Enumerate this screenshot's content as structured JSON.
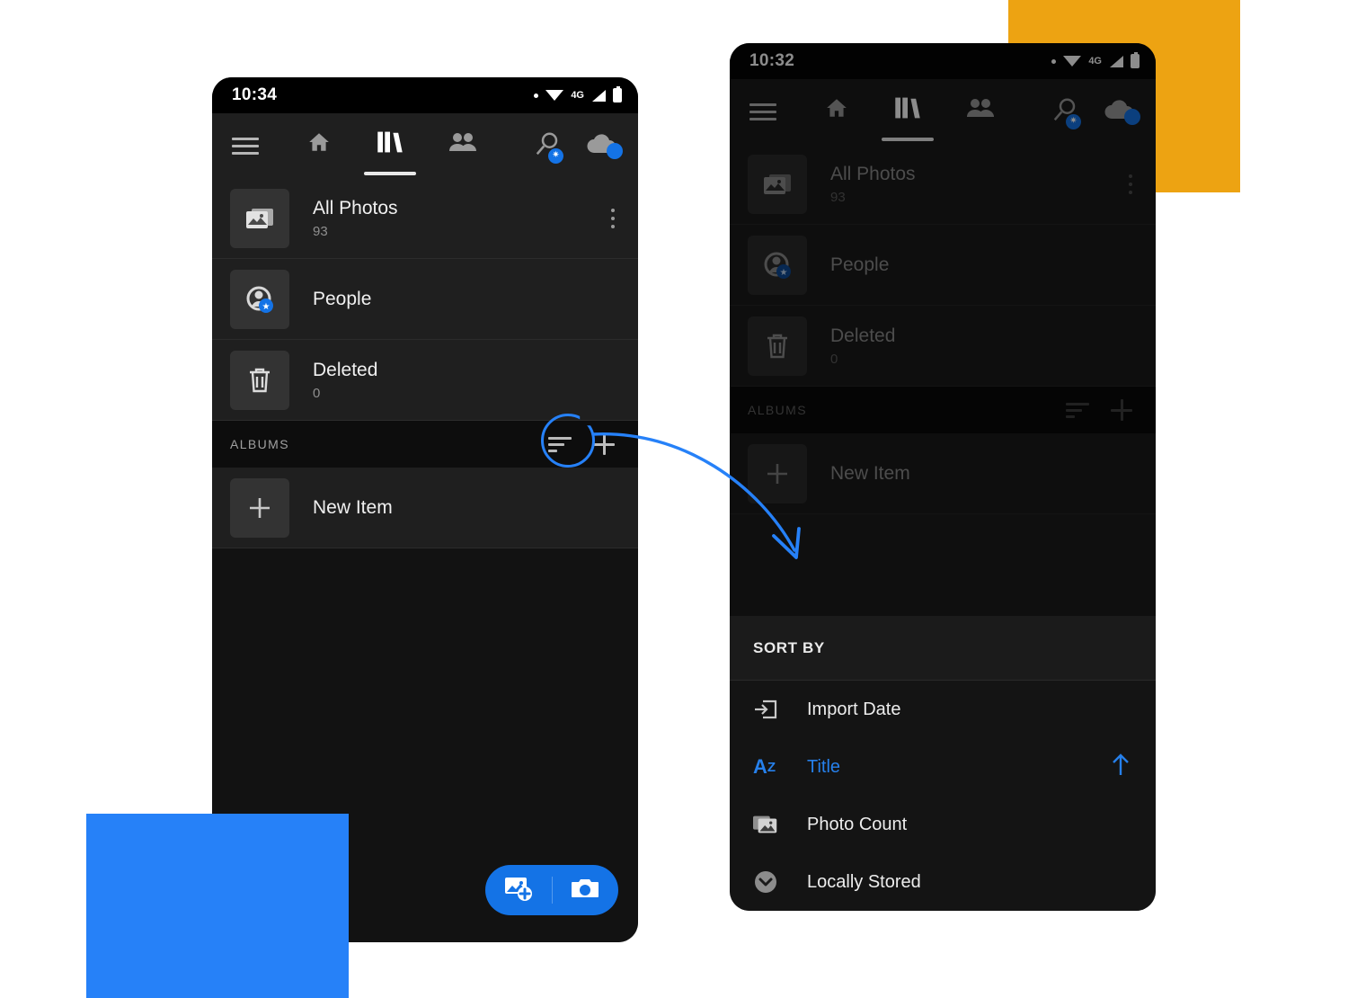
{
  "palette": {
    "accent_blue": "#2681f8",
    "adobe_blue": "#1473e6",
    "amber": "#eda312",
    "selected_blue": "#2680eb",
    "phone_bg": "#121212",
    "row_bg": "#1f1f1f",
    "section_bg": "#0d0d0d"
  },
  "phone_left": {
    "status": {
      "time": "10:34",
      "network": "4G",
      "icons": [
        "dot-icon",
        "wifi-icon",
        "signal-icon",
        "battery-icon"
      ]
    },
    "toolbar": {
      "menu_icon": "hamburger-icon",
      "tabs": [
        {
          "name": "home",
          "icon": "home-icon",
          "active": false
        },
        {
          "name": "library",
          "icon": "books-icon",
          "active": true
        },
        {
          "name": "shared",
          "icon": "people-icon",
          "active": false
        }
      ],
      "search_icon": "search-icon",
      "cloud_icon": "cloud-icon"
    },
    "rows": [
      {
        "title": "All Photos",
        "count": "93",
        "icon": "photos-stack-icon",
        "kebab": true
      },
      {
        "title": "People",
        "count": "",
        "icon": "person-star-icon",
        "kebab": false
      },
      {
        "title": "Deleted",
        "count": "0",
        "icon": "trash-icon",
        "kebab": false
      }
    ],
    "section": {
      "label": "ALBUMS",
      "sort_icon": "sort-icon",
      "add_icon": "plus-icon"
    },
    "new_item": {
      "title": "New Item",
      "icon": "plus-icon"
    },
    "fab": {
      "add_photo_icon": "add-photo-icon",
      "camera_icon": "camera-icon"
    }
  },
  "phone_right": {
    "status": {
      "time": "10:32",
      "network": "4G",
      "icons": [
        "dot-icon",
        "wifi-icon",
        "signal-icon",
        "battery-icon"
      ]
    },
    "toolbar": {
      "menu_icon": "hamburger-icon",
      "tabs": [
        {
          "name": "home",
          "icon": "home-icon",
          "active": false
        },
        {
          "name": "library",
          "icon": "books-icon",
          "active": true
        },
        {
          "name": "shared",
          "icon": "people-icon",
          "active": false
        }
      ],
      "search_icon": "search-icon",
      "cloud_icon": "cloud-icon"
    },
    "rows": [
      {
        "title": "All Photos",
        "count": "93",
        "icon": "photos-stack-icon",
        "kebab": true
      },
      {
        "title": "People",
        "count": "",
        "icon": "person-star-icon",
        "kebab": false
      },
      {
        "title": "Deleted",
        "count": "0",
        "icon": "trash-icon",
        "kebab": false
      }
    ],
    "section": {
      "label": "ALBUMS",
      "sort_icon": "sort-icon",
      "add_icon": "plus-icon"
    },
    "new_item": {
      "title": "New Item",
      "icon": "plus-icon"
    },
    "sort_sheet": {
      "heading": "SORT BY",
      "options": [
        {
          "label": "Import Date",
          "icon": "import-icon",
          "selected": false,
          "direction": ""
        },
        {
          "label": "Title",
          "icon": "az-icon",
          "selected": true,
          "direction": "arrow-up-icon"
        },
        {
          "label": "Photo Count",
          "icon": "photos-stack-icon",
          "selected": false,
          "direction": ""
        },
        {
          "label": "Locally Stored",
          "icon": "download-circle-icon",
          "selected": false,
          "direction": ""
        }
      ]
    }
  },
  "annotations": {
    "highlight_circle": "sort-icon-highlight",
    "arrow": "curved-arrow-to-sort-sheet"
  }
}
